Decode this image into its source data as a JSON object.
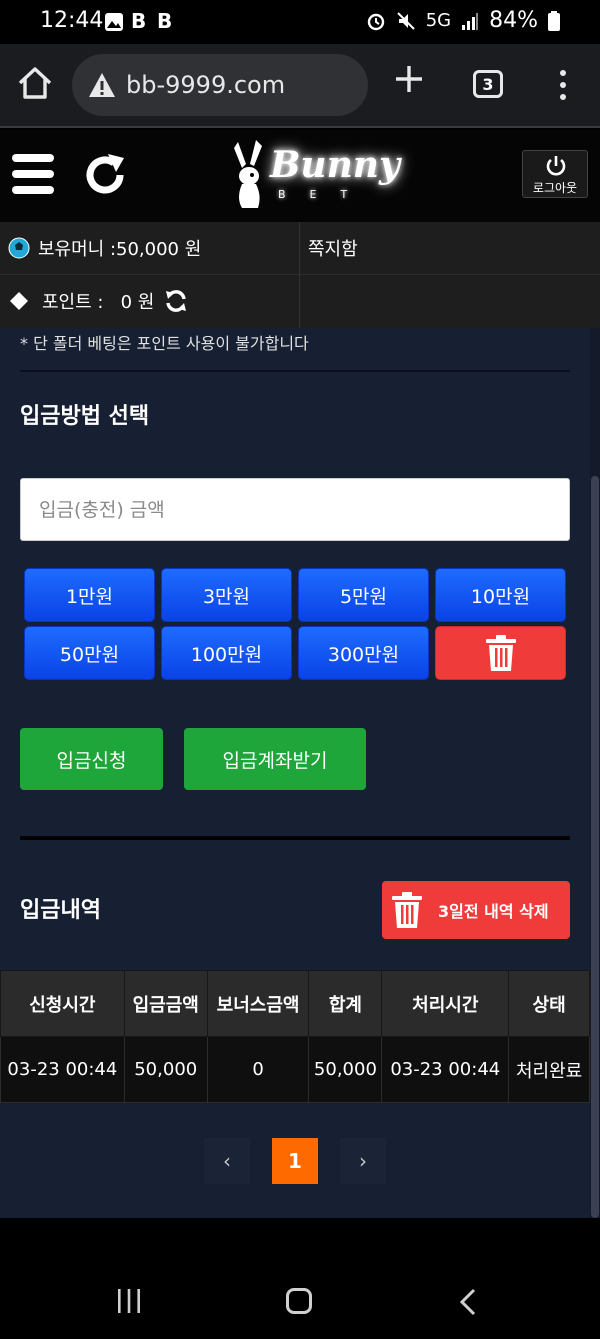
{
  "status_bar": {
    "time": "12:44",
    "notif_1": "B",
    "notif_2": "B",
    "network": "5G",
    "battery": "84%"
  },
  "browser": {
    "url": "bb-9999.com",
    "tab_count": "3"
  },
  "header": {
    "logo_text": "Bunny",
    "logo_sub": "BET",
    "logout_label": "로그아웃"
  },
  "info": {
    "money": "보유머니 :50,000 원",
    "messages": "쪽지함",
    "points": "포인트 :   0 원"
  },
  "deposit": {
    "notice": "* 단 폴더 베팅은 포인트 사용이 불가합니다",
    "method_title": "입금방법 선택",
    "amount_placeholder": "입금(충전) 금액",
    "amount_buttons": [
      "1만원",
      "3만원",
      "5만원",
      "10만원",
      "50만원",
      "100만원",
      "300만원"
    ],
    "apply_label": "입금신청",
    "account_label": "입금계좌받기"
  },
  "history": {
    "title": "입금내역",
    "delete_label": "3일전 내역 삭제",
    "columns": [
      "신청시간",
      "입금금액",
      "보너스금액",
      "합계",
      "처리시간",
      "상태"
    ],
    "rows": [
      [
        "03-23 00:44",
        "50,000",
        "0",
        "50,000",
        "03-23 00:44",
        "처리완료"
      ]
    ]
  },
  "pagination": {
    "prev": "‹",
    "current": "1",
    "next": "›"
  },
  "colors": {
    "accent_blue": "#1e6cff",
    "danger_red": "#f03b3b",
    "success_green": "#1ea63a",
    "page_orange": "#ff6a00",
    "content_bg": "#171f33"
  }
}
